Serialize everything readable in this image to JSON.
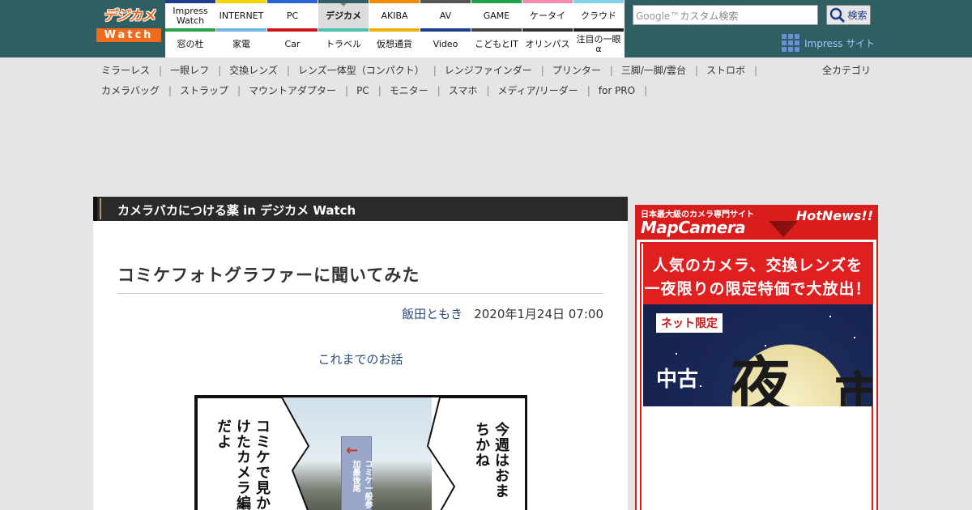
{
  "header": {
    "logo_top": "デジカメ",
    "logo_bottom": "Watch",
    "nav_row1": [
      {
        "label": "Impress\nWatch",
        "color": "#1d3d8f"
      },
      {
        "label": "INTERNET",
        "color": "#f4d400"
      },
      {
        "label": "PC",
        "color": "#2b63d8"
      },
      {
        "label": "デジカメ",
        "color": "#2f5f62",
        "active": true
      },
      {
        "label": "AKIBA",
        "color": "#f08a00"
      },
      {
        "label": "AV",
        "color": "#555555"
      },
      {
        "label": "GAME",
        "color": "#23a04a"
      },
      {
        "label": "ケータイ",
        "color": "#f28cb1"
      },
      {
        "label": "クラウド",
        "color": "#7fd3e8"
      }
    ],
    "nav_row2": [
      {
        "label": "窓の杜",
        "color": "#2aa14a"
      },
      {
        "label": "家電",
        "color": "#6fb6e6"
      },
      {
        "label": "Car",
        "color": "#c81818"
      },
      {
        "label": "トラベル",
        "color": "#4fc0b0"
      },
      {
        "label": "仮想通貨",
        "color": "#f0b000"
      },
      {
        "label": "Video",
        "color": "#1d3d8f"
      },
      {
        "label": "こどもとIT",
        "color": "#444444"
      },
      {
        "label": "オリンパス",
        "color": "#333333"
      },
      {
        "label": "注目の一眼\nα",
        "color": "#222222"
      }
    ],
    "search_placeholder": "カスタム検索",
    "search_brand": "Google™",
    "search_button": "検索",
    "impress_link": "Impress サイト"
  },
  "categories": {
    "row1": [
      "ミラーレス",
      "一眼レフ",
      "交換レンズ",
      "レンズ一体型（コンパクト）",
      "レンジファインダー",
      "プリンター",
      "三脚/一脚/雲台",
      "ストロボ"
    ],
    "row2": [
      "カメラバッグ",
      "ストラップ",
      "マウントアダプター",
      "PC",
      "モニター",
      "スマホ",
      "メディア/リーダー",
      "for PRO"
    ],
    "all": "全カテゴリ"
  },
  "article": {
    "section_title": "カメラバカにつける薬 in デジカメ Watch",
    "title": "コミケフォトグラファーに聞いてみた",
    "author": "飯田ともき",
    "date": "2020年1月24日 07:00",
    "prev_link": "これまでのお話",
    "comic_left_text": "コミケで見かけたカメラ編だよ",
    "comic_right_text": "今週はおまちかね",
    "comic_sign_text": "コミケ一般参加最後尾"
  },
  "ad": {
    "tagline": "日本最大級のカメラ専門サイト",
    "brand": "MapCamera",
    "hotnews": "HotNews!!",
    "line1": "人気のカメラ、交換レンズを",
    "line2": "一夜限りの限定特価で大放出！",
    "badge": "ネット限定",
    "used": "中古",
    "big": "夜",
    "big2": "市"
  }
}
